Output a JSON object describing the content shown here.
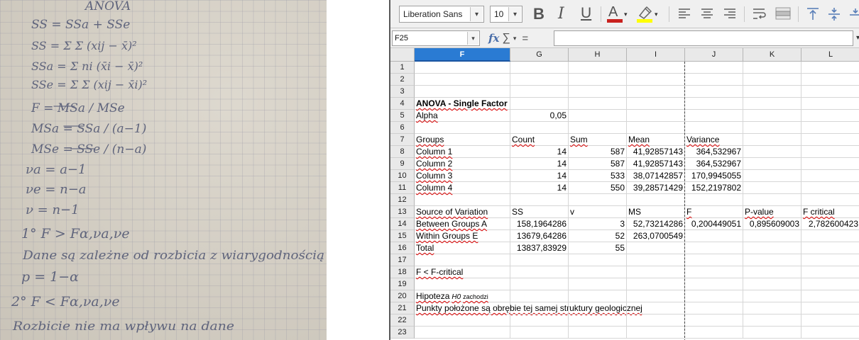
{
  "notebook": {
    "lines": [
      "ANOVA",
      "SS = SSa + SSe",
      "SS = Σ Σ (xij − x̄)²",
      "SSa = Σ ni (x̄i − x̄)²",
      "SSe = Σ Σ (xij − x̄i)²",
      "F = MSa / MSe",
      "MSa = SSa / (a−1)",
      "MSe = SSe / (n−a)",
      "νa = a−1",
      "νe = n−a",
      "ν = n−1",
      "1° F > Fα,νa,νe",
      "Dane są zależne od rozbicia z wiarygodnością",
      "p = 1−α",
      "2° F < Fα,νa,νe",
      "Rozbicie nie ma wpływu na dane"
    ]
  },
  "toolbar": {
    "font_name": "Liberation Sans",
    "font_size": "10",
    "bold_label": "B",
    "italic_label": "I",
    "underline_label": "U",
    "font_color_label": "A",
    "font_color": "#c9211e",
    "highlight_color": "#ffff00"
  },
  "formula_bar": {
    "cell_ref": "F25",
    "fx_label": "fx",
    "sigma_label": "∑",
    "equals_label": "=",
    "content": ""
  },
  "sheet": {
    "selected_column": "F",
    "columns": [
      "F",
      "G",
      "H",
      "I",
      "J",
      "K",
      "L"
    ],
    "rows": [
      "1",
      "2",
      "3",
      "4",
      "5",
      "6",
      "7",
      "8",
      "9",
      "10",
      "11",
      "12",
      "13",
      "14",
      "15",
      "16",
      "17",
      "18",
      "19",
      "20",
      "21",
      "22",
      "23"
    ],
    "cells": {
      "r4": {
        "f": "ANOVA - Single Factor"
      },
      "r5": {
        "f": "Alpha",
        "g": "0,05"
      },
      "r7": {
        "f": "Groups",
        "g": "Count",
        "h": "Sum",
        "i": "Mean",
        "j": "Variance"
      },
      "r8": {
        "f": "Column 1",
        "g": "14",
        "h": "587",
        "i": "41,92857143",
        "j": "364,532967"
      },
      "r9": {
        "f": "Column 2",
        "g": "14",
        "h": "587",
        "i": "41,92857143",
        "j": "364,532967"
      },
      "r10": {
        "f": "Column 3",
        "g": "14",
        "h": "533",
        "i": "38,07142857",
        "j": "170,9945055"
      },
      "r11": {
        "f": "Column 4",
        "g": "14",
        "h": "550",
        "i": "39,28571429",
        "j": "152,2197802"
      },
      "r13": {
        "f": "Source of Variation",
        "g": "SS",
        "h": "v",
        "i": "MS",
        "j": "F",
        "k": "P-value",
        "l": "F critical"
      },
      "r14": {
        "f": "Between Groups A",
        "g": "158,1964286",
        "h": "3",
        "i": "52,73214286",
        "j": "0,200449051",
        "k": "0,895609003",
        "l": "2,782600423"
      },
      "r15": {
        "f": "Within Groups E",
        "g": "13679,64286",
        "h": "52",
        "i": "263,0700549"
      },
      "r16": {
        "f": "Total",
        "g": "13837,83929",
        "h": "55"
      },
      "r18": {
        "f": "F < F-critical"
      },
      "r20": {
        "f": "Hipoteza",
        "f_italic": "H0",
        "f_small": "zachodzi"
      },
      "r21": {
        "f": "Punkty położone są obrębie tej samej struktury geologicznej"
      }
    }
  }
}
